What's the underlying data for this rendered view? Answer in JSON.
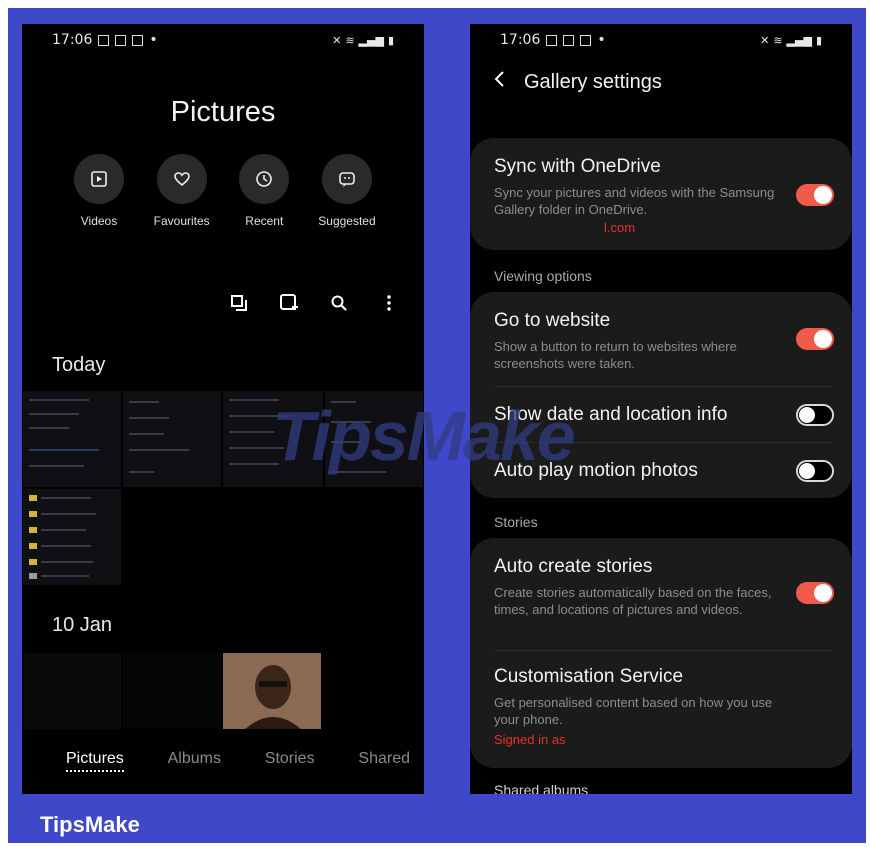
{
  "left": {
    "status_time": "17:06",
    "title": "Pictures",
    "shortcuts": [
      {
        "label": "Videos",
        "icon": "play-icon"
      },
      {
        "label": "Favourites",
        "icon": "heart-icon"
      },
      {
        "label": "Recent",
        "icon": "clock-icon"
      },
      {
        "label": "Suggested",
        "icon": "sparkle-icon"
      }
    ],
    "section_today": "Today",
    "section_jan": "10 Jan",
    "tabs": [
      "Pictures",
      "Albums",
      "Stories",
      "Shared"
    ]
  },
  "right": {
    "status_time": "17:06",
    "header": "Gallery settings",
    "sync": {
      "title": "Sync with OneDrive",
      "desc": "Sync your pictures and videos with the Samsung Gallery folder in OneDrive.",
      "account": "l.com",
      "on": true
    },
    "viewing_options": "Viewing options",
    "website": {
      "title": "Go to website",
      "desc": "Show a button to return to websites where screenshots were taken.",
      "on": true
    },
    "date_location": {
      "title": "Show date and location info",
      "on": false
    },
    "motion": {
      "title": "Auto play motion photos",
      "on": false
    },
    "stories": "Stories",
    "auto_stories": {
      "title": "Auto create stories",
      "desc": "Create stories automatically based on the faces, times, and locations of pictures and videos.",
      "on": true
    },
    "custom": {
      "title": "Customisation Service",
      "desc": "Get personalised content based on how you use your phone.",
      "signed": "Signed in as"
    },
    "shared_albums": "Shared albums"
  },
  "watermark": "TipsMake",
  "brand": "TipsMake",
  "colors": {
    "frame": "#3f48c8",
    "toggle_on": "#ef5a4b",
    "card": "#1b1b1b"
  }
}
